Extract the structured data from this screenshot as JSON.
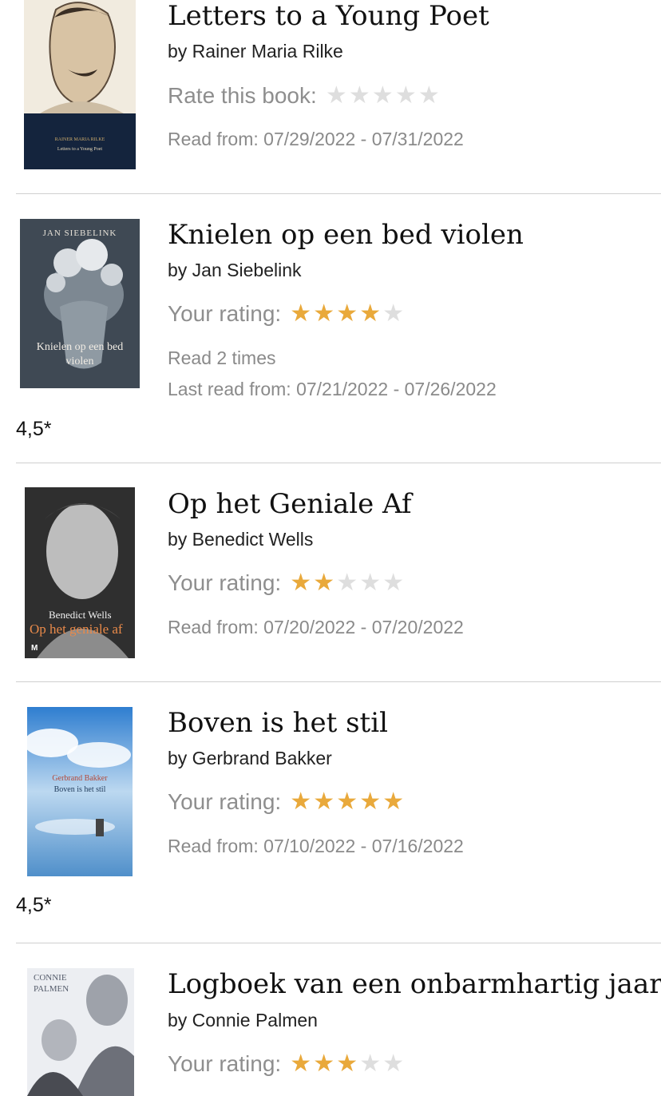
{
  "books": [
    {
      "title": "Letters to a Young Poet",
      "author": "by Rainer Maria Rilke",
      "rating_label": "Rate this book:",
      "rating": 0,
      "meta_lines": [
        "Read from: 07/29/2022 - 07/31/2022"
      ],
      "note": "",
      "cover": {
        "lines": [
          "RAINER MARIA RILKE",
          "Letters to a Young Poet"
        ]
      }
    },
    {
      "title": "Knielen op een bed violen",
      "author": "by Jan Siebelink",
      "rating_label": "Your rating:",
      "rating": 4,
      "meta_lines": [
        "Read 2 times",
        "Last read from: 07/21/2022 - 07/26/2022"
      ],
      "note": "4,5*",
      "cover": {
        "lines": [
          "JAN SIEBELINK",
          "Knielen op een bed violen"
        ]
      }
    },
    {
      "title": "Op het Geniale Af",
      "author": "by Benedict Wells",
      "rating_label": "Your rating:",
      "rating": 2,
      "meta_lines": [
        "Read from: 07/20/2022 - 07/20/2022"
      ],
      "note": "",
      "cover": {
        "lines": [
          "Benedict Wells",
          "Op het geniale af",
          "M"
        ]
      }
    },
    {
      "title": "Boven is het stil",
      "author": "by Gerbrand Bakker",
      "rating_label": "Your rating:",
      "rating": 5,
      "meta_lines": [
        "Read from: 07/10/2022 - 07/16/2022"
      ],
      "note": "4,5*",
      "cover": {
        "lines": [
          "Gerbrand Bakker",
          "Boven is het stil"
        ]
      }
    },
    {
      "title": "Logboek van een onbarmhartig jaar",
      "author": "by Connie Palmen",
      "rating_label": "Your rating:",
      "rating": 3,
      "meta_lines": [],
      "note": "",
      "cover": {
        "lines": [
          "CONNIE",
          "PALMEN"
        ]
      }
    }
  ],
  "max_rating": 5,
  "colors": {
    "star_on": "#e9a93b",
    "star_off": "#dedede",
    "divider": "#cfcfcf"
  },
  "icons": {
    "star": "star-icon"
  }
}
